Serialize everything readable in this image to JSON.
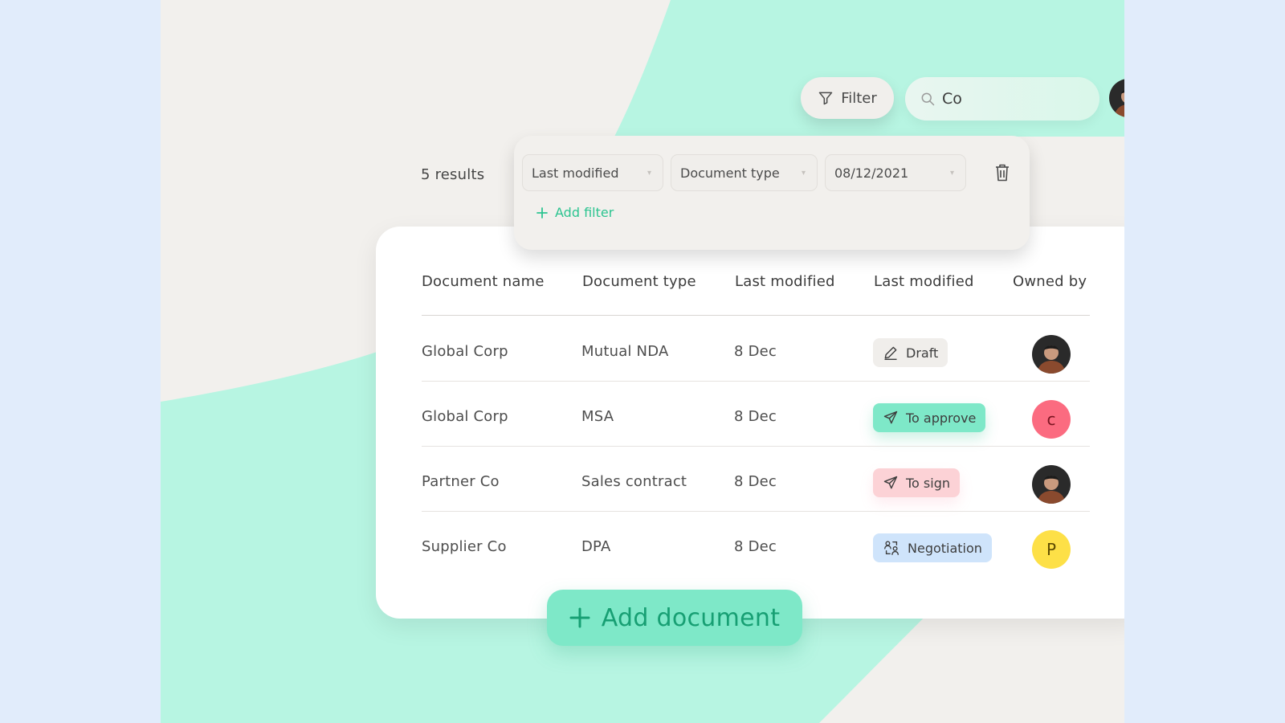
{
  "toolbar": {
    "filter_label": "Filter",
    "search_value": "Co"
  },
  "results_label": "5 results",
  "filters": {
    "selects": [
      {
        "value": "Last modified"
      },
      {
        "value": "Document type"
      },
      {
        "value": "08/12/2021"
      }
    ],
    "add_filter_label": "Add filter"
  },
  "table": {
    "headers": [
      "Document name",
      "Document type",
      "Last modified",
      "Last modified",
      "Owned by"
    ],
    "rows": [
      {
        "name": "Global Corp",
        "type": "Mutual NDA",
        "modified": "8 Dec",
        "status": "Draft",
        "status_icon": "pencil-icon",
        "owner": "photo"
      },
      {
        "name": "Global Corp",
        "type": "MSA",
        "modified": "8 Dec",
        "status": "To approve",
        "status_icon": "send-icon",
        "owner": "c"
      },
      {
        "name": "Partner Co",
        "type": "Sales contract",
        "modified": "8 Dec",
        "status": "To sign",
        "status_icon": "send-icon",
        "owner": "photo"
      },
      {
        "name": "Supplier Co",
        "type": "DPA",
        "modified": "8 Dec",
        "status": "Negotiation",
        "status_icon": "users-swap-icon",
        "owner": "P"
      }
    ]
  },
  "add_document_label": "Add document",
  "colors": {
    "mint": "#b7f5e2",
    "accent_green": "#2cc490",
    "draft_bg": "#f0eeeb",
    "approve_bg": "#7ee8c8",
    "sign_bg": "#fcd2d6",
    "negotiation_bg": "#cfe4fb",
    "avatar_c": "#fb6b80",
    "avatar_p": "#fde047"
  }
}
